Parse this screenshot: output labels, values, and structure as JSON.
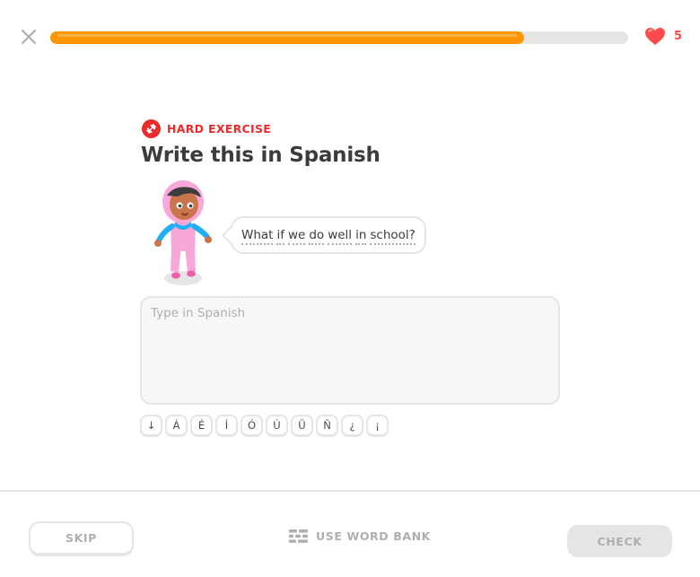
{
  "header": {
    "close_icon": "close-icon",
    "progress": {
      "fraction": 0.82,
      "fill_color": "#ff9600"
    },
    "hearts": {
      "icon": "heart-icon",
      "count": "5",
      "color": "#ff4b4b"
    }
  },
  "challenge": {
    "badge_icon": "dumbbell-icon",
    "badge_label": "HARD EXERCISE",
    "badge_color": "#ea2b2b",
    "title": "Write this in Spanish",
    "prompt_words": [
      "What",
      "if",
      "we",
      "do",
      "well",
      "in",
      "school?"
    ]
  },
  "answer": {
    "placeholder": "Type in Spanish",
    "value": ""
  },
  "special_keys": [
    "↓",
    "Á",
    "É",
    "Í",
    "Ó",
    "Ú",
    "Ü",
    "Ñ",
    "¿",
    "¡"
  ],
  "footer": {
    "skip_label": "SKIP",
    "word_bank_icon": "word-bank-icon",
    "word_bank_label": "USE WORD BANK",
    "check_label": "CHECK"
  }
}
